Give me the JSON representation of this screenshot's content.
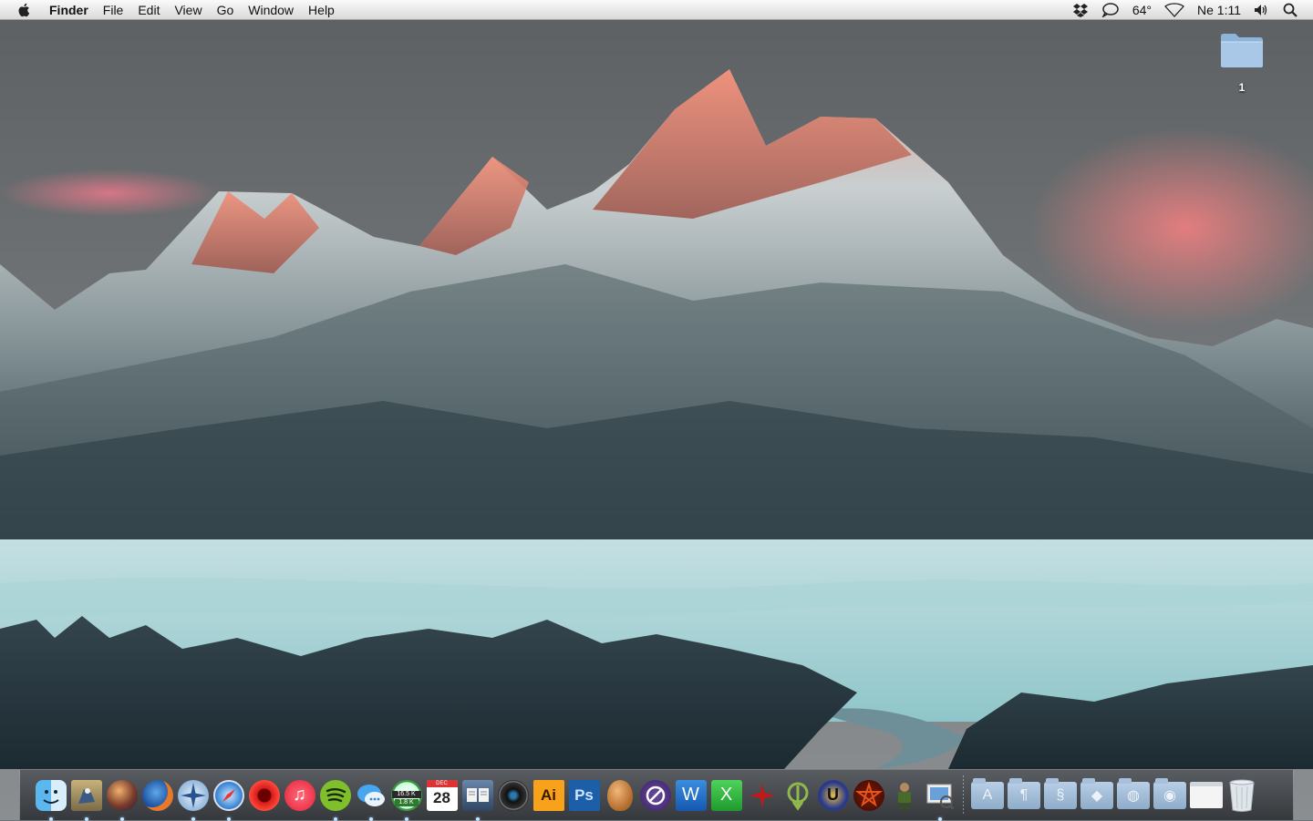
{
  "menubar": {
    "app_name": "Finder",
    "menus": [
      "File",
      "Edit",
      "View",
      "Go",
      "Window",
      "Help"
    ],
    "status": {
      "temperature": "64°",
      "clock": "Ne 1:11"
    }
  },
  "desktop": {
    "icons": [
      {
        "label": "1",
        "icon": "folder-icon"
      }
    ]
  },
  "dock": {
    "apps": [
      {
        "name": "finder-icon",
        "running": true
      },
      {
        "name": "mail-eagle-icon",
        "running": true
      },
      {
        "name": "firefox-nightly-icon",
        "running": true
      },
      {
        "name": "firefox-icon",
        "running": false
      },
      {
        "name": "compass-icon",
        "running": true
      },
      {
        "name": "safari-icon",
        "running": true
      },
      {
        "name": "opera-icon",
        "running": false
      },
      {
        "name": "itunes-icon",
        "running": false
      },
      {
        "name": "spotify-icon",
        "running": true
      },
      {
        "name": "messages-icon",
        "running": true
      },
      {
        "name": "utorrent-icon",
        "running": true,
        "upper": "16.5 K",
        "lower": "1.8 K"
      },
      {
        "name": "calendar-icon",
        "running": false,
        "month": "DEC",
        "day": "28"
      },
      {
        "name": "book-icon",
        "running": true
      },
      {
        "name": "camera-icon",
        "running": false
      },
      {
        "name": "illustrator-icon",
        "running": false,
        "text": "Ai"
      },
      {
        "name": "photoshop-icon",
        "running": false,
        "text": "Ps"
      },
      {
        "name": "egg-icon",
        "running": false
      },
      {
        "name": "disabled-icon",
        "running": false
      },
      {
        "name": "word-icon",
        "running": false,
        "text": "W"
      },
      {
        "name": "excel-icon",
        "running": false,
        "text": "X"
      },
      {
        "name": "game-red-icon",
        "running": false
      },
      {
        "name": "quake-icon",
        "running": false
      },
      {
        "name": "unreal-icon",
        "running": false
      },
      {
        "name": "pentagram-icon",
        "running": false
      },
      {
        "name": "doom-icon",
        "running": false
      },
      {
        "name": "preview-icon",
        "running": true
      }
    ],
    "stacks": [
      {
        "name": "applications-stack-icon",
        "glyph": "A"
      },
      {
        "name": "documents-stack-icon",
        "glyph": "¶"
      },
      {
        "name": "scripts-stack-icon",
        "glyph": "§"
      },
      {
        "name": "dropbox-stack-icon",
        "glyph": "◆"
      },
      {
        "name": "web-stack-icon",
        "glyph": "◍"
      },
      {
        "name": "downloads-stack-icon",
        "glyph": "◉"
      }
    ],
    "colors": {
      "running_dot": "#bfe7ff"
    }
  }
}
